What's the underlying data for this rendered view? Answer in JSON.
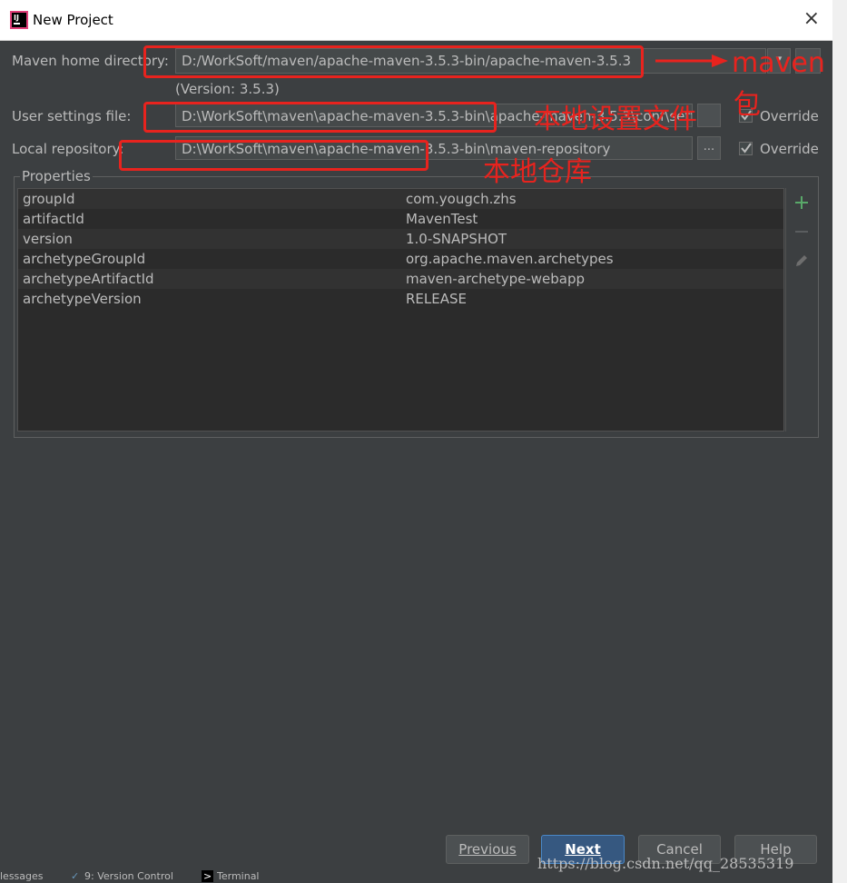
{
  "window": {
    "title": "New Project",
    "close_glyph": "×"
  },
  "form": {
    "maven_home": {
      "label": "Maven home directory:",
      "value": "D:/WorkSoft/maven/apache-maven-3.5.3-bin/apache-maven-3.5.3",
      "version_note": "(Version: 3.5.3)"
    },
    "user_settings": {
      "label": "User settings file:",
      "value": "D:\\WorkSoft\\maven\\apache-maven-3.5.3-bin\\apache-maven-3.5.3\\conf\\setti",
      "override_label": "Override",
      "override_checked": true
    },
    "local_repository": {
      "label": "Local repository:",
      "value": "D:\\WorkSoft\\maven\\apache-maven-3.5.3-bin\\maven-repository",
      "browse_label": "...",
      "override_label": "Override",
      "override_checked": true
    }
  },
  "properties": {
    "legend": "Properties",
    "rows": [
      {
        "key": "groupId",
        "value": "com.yougch.zhs"
      },
      {
        "key": "artifactId",
        "value": "MavenTest"
      },
      {
        "key": "version",
        "value": "1.0-SNAPSHOT"
      },
      {
        "key": "archetypeGroupId",
        "value": "org.apache.maven.archetypes"
      },
      {
        "key": "archetypeArtifactId",
        "value": "maven-archetype-webapp"
      },
      {
        "key": "archetypeVersion",
        "value": "RELEASE"
      }
    ],
    "toolbar_icons": [
      "plus-icon",
      "minus-icon",
      "pencil-icon"
    ]
  },
  "buttons": {
    "previous": "Previous",
    "next": "Next",
    "cancel": "Cancel",
    "help": "Help"
  },
  "statusbar": {
    "messages": "lessages",
    "version_control": "9: Version Control",
    "terminal": "Terminal"
  },
  "watermark": "https://blog.csdn.net/qq_28535319",
  "annotations": {
    "maven_package_line1": "maven",
    "maven_package_line2": "包",
    "local_settings": "本地设置文件",
    "local_repo": "本地仓库"
  },
  "colors": {
    "background": "#3c3f41",
    "annotation_red": "#e8231e",
    "accent_blue": "#365880",
    "add_green": "#59a869"
  }
}
